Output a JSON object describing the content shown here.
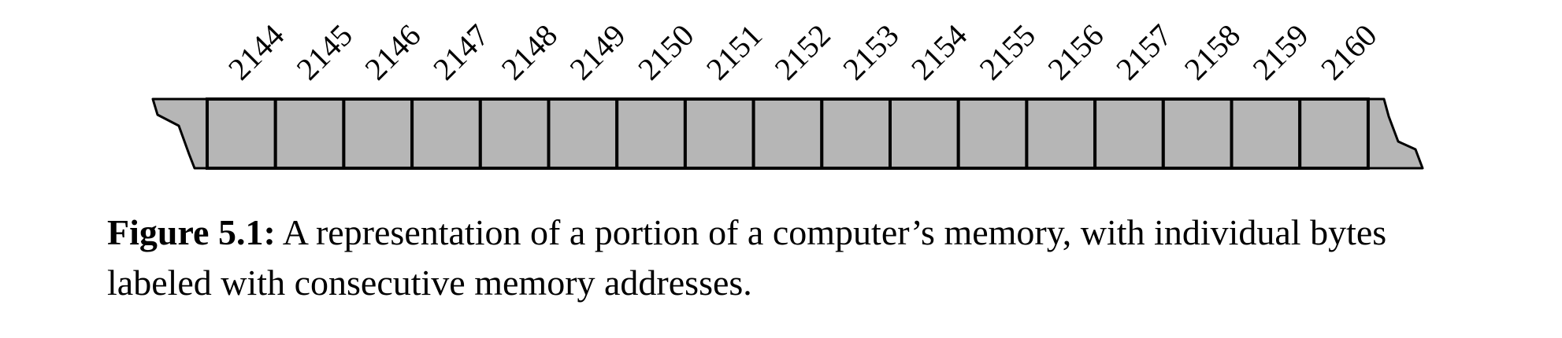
{
  "figure": {
    "label": "Figure 5.1:",
    "caption": "A representation of a portion of a computer’s memory, with individual bytes labeled with consecutive memory addresses."
  },
  "memory": {
    "addresses": [
      "2144",
      "2145",
      "2146",
      "2147",
      "2148",
      "2149",
      "2150",
      "2151",
      "2152",
      "2153",
      "2154",
      "2155",
      "2156",
      "2157",
      "2158",
      "2159",
      "2160"
    ]
  },
  "colors": {
    "cell_fill": "#b6b6b6",
    "stroke": "#000000"
  }
}
